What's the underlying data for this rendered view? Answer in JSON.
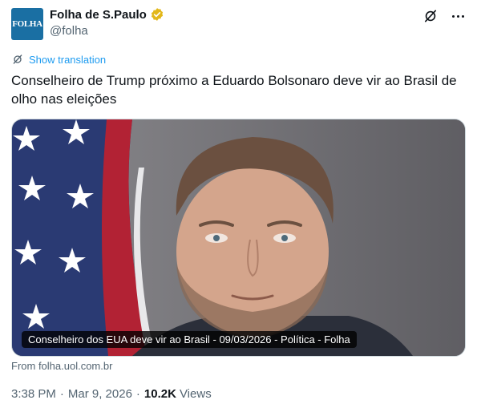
{
  "author": {
    "avatar_text": "FOLHA",
    "display_name": "Folha de S.Paulo",
    "handle": "@folha",
    "verified_color": "#e2b719",
    "avatar_color": "#1a6fa3"
  },
  "icons": {
    "verified": "verified-badge-icon",
    "grok": "grok-icon",
    "more": "more-options-icon",
    "translate": "translate-icon"
  },
  "translate": {
    "label": "Show translation"
  },
  "tweet": {
    "text": "Conselheiro de Trump próximo a Eduardo Bolsonaro deve vir ao Brasil de olho nas eleições"
  },
  "card": {
    "title": "Conselheiro dos EUA deve vir ao Brasil - 09/03/2026 - Política - Folha",
    "source": "From folha.uol.com.br"
  },
  "meta": {
    "time": "3:38 PM",
    "separator": "·",
    "date": "Mar 9, 2026",
    "views_count": "10.2K",
    "views_label": "Views"
  },
  "colors": {
    "link": "#1d9bf0",
    "secondary_text": "#536471",
    "primary_text": "#0f1419"
  }
}
